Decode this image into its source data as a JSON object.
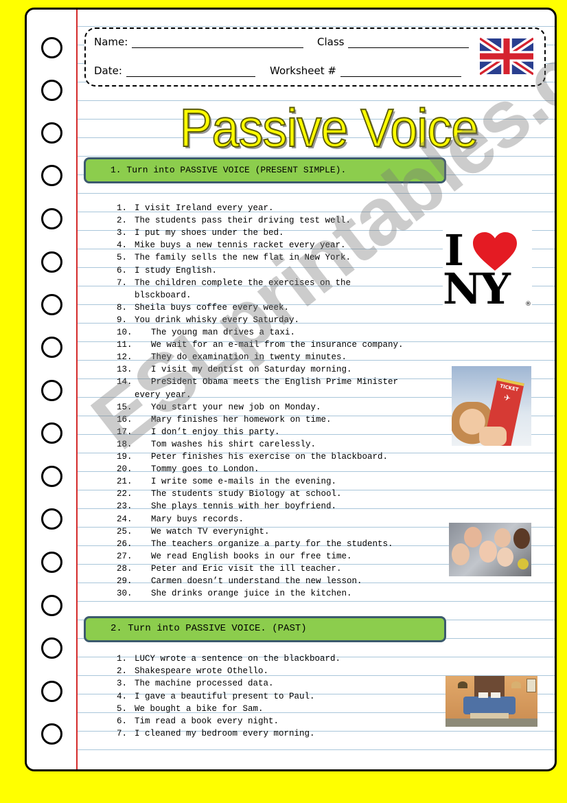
{
  "header": {
    "name_label": "Name:",
    "class_label": "Class",
    "date_label": "Date:",
    "worksheet_label": "Worksheet #",
    "flag_icon": "union-jack-flag"
  },
  "title": "Passive Voice",
  "colors": {
    "background": "#ffff00",
    "section_bar": "#8ccd4d",
    "section_border": "#3c5a6e",
    "margin_line": "#d42a2a",
    "ruled_line": "#a9c6da",
    "title_fill": "#ffff00"
  },
  "sections": [
    {
      "heading": "1. Turn into PASSIVE VOICE (PRESENT SIMPLE).",
      "items": [
        {
          "n": "1.",
          "text": "I visit Ireland every year."
        },
        {
          "n": "2.",
          "text": "The students pass their driving test well."
        },
        {
          "n": "3.",
          "text": "I put my shoes under the bed."
        },
        {
          "n": "4.",
          "text": "Mike buys a new tennis racket every year."
        },
        {
          "n": "5.",
          "text": "The family sells the new flat in New York."
        },
        {
          "n": "6.",
          "text": "I study English."
        },
        {
          "n": "7.",
          "text": "The children complete the exercises on the",
          "cont": "blsckboard."
        },
        {
          "n": "8.",
          "text": "Sheila buys coffee every week."
        },
        {
          "n": "9.",
          "text": "You drink whisky every Saturday."
        },
        {
          "n": "10.",
          "text": "The young man drives a taxi."
        },
        {
          "n": "11.",
          "text": "We wait for an e-mail from the insurance company."
        },
        {
          "n": "12.",
          "text": "They do examination in twenty minutes."
        },
        {
          "n": "13.",
          "text": "I visit my dentist on Saturday morning."
        },
        {
          "n": "14.",
          "text": "PreSident Obama meets the English Prime Minister",
          "cont": "every year."
        },
        {
          "n": "15.",
          "text": "You start your new job on Monday."
        },
        {
          "n": "16.",
          "text": "Mary finishes her homework on time."
        },
        {
          "n": "17.",
          "text": "I don’t enjoy this party."
        },
        {
          "n": "18.",
          "text": "Tom washes his shirt carelessly."
        },
        {
          "n": "19.",
          "text": "Peter finishes his exercise on the blackboard."
        },
        {
          "n": "20.",
          "text": "Tommy goes to London."
        },
        {
          "n": "21.",
          "text": "I write some e-mails in the evening."
        },
        {
          "n": "22.",
          "text": "The students study Biology at school."
        },
        {
          "n": "23.",
          "text": "She plays tennis with her boyfriend."
        },
        {
          "n": "24.",
          "text": "Mary buys records."
        },
        {
          "n": "25.",
          "text": "We watch TV everynight."
        },
        {
          "n": "26.",
          "text": "The teachers organize a party for the students."
        },
        {
          "n": "27.",
          "text": "We read English books in our free time."
        },
        {
          "n": "28.",
          "text": "Peter and Eric visit the ill teacher."
        },
        {
          "n": "29.",
          "text": "Carmen doesn’t understand the new lesson."
        },
        {
          "n": "30.",
          "text": "She drinks orange juice in the kitchen."
        }
      ]
    },
    {
      "heading": "2. Turn into PASSIVE VOICE. (PAST)",
      "items": [
        {
          "n": "1.",
          "text": "LUCY wrote a sentence on the blackboard."
        },
        {
          "n": "2.",
          "text": "Shakespeare wrote Othello."
        },
        {
          "n": "3.",
          "text": "The machine processed data."
        },
        {
          "n": "4.",
          "text": "I gave a beautiful present to Paul."
        },
        {
          "n": "5.",
          "text": "We bought a bike for Sam."
        },
        {
          "n": "6.",
          "text": "Tim read a book every night."
        },
        {
          "n": "7.",
          "text": "I cleaned my bedroom every morning."
        }
      ]
    }
  ],
  "images": {
    "i_love_ny": {
      "line1": "I",
      "line2": "NY",
      "mark": "®"
    },
    "ticket": {
      "label": "TICKET"
    },
    "students_group": {},
    "bedroom": {}
  },
  "watermark": "ESLprintables.com"
}
